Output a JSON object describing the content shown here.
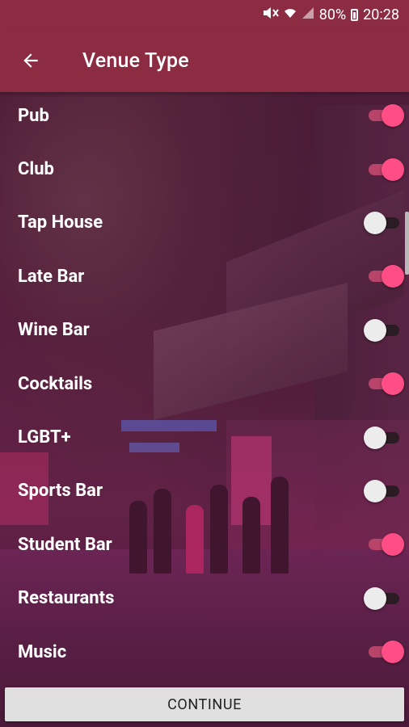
{
  "status_bar": {
    "battery": "80%",
    "time": "20:28",
    "icons": [
      "mute-icon",
      "wifi-icon",
      "signal-icon",
      "battery-icon"
    ]
  },
  "app_bar": {
    "title": "Venue Type",
    "back_icon": "arrow-back-icon"
  },
  "venue_types": [
    {
      "label": "Pub",
      "enabled": true
    },
    {
      "label": "Club",
      "enabled": true
    },
    {
      "label": "Tap House",
      "enabled": false
    },
    {
      "label": "Late Bar",
      "enabled": true
    },
    {
      "label": "Wine Bar",
      "enabled": false
    },
    {
      "label": "Cocktails",
      "enabled": true
    },
    {
      "label": "LGBT+",
      "enabled": false
    },
    {
      "label": "Sports Bar",
      "enabled": false
    },
    {
      "label": "Student Bar",
      "enabled": true
    },
    {
      "label": "Restaurants",
      "enabled": false
    },
    {
      "label": "Music",
      "enabled": true
    }
  ],
  "continue_button": {
    "label": "CONTINUE"
  },
  "colors": {
    "app_bar": "#8c2c43",
    "switch_on": "#ff4d86",
    "switch_off": "#ececec"
  }
}
